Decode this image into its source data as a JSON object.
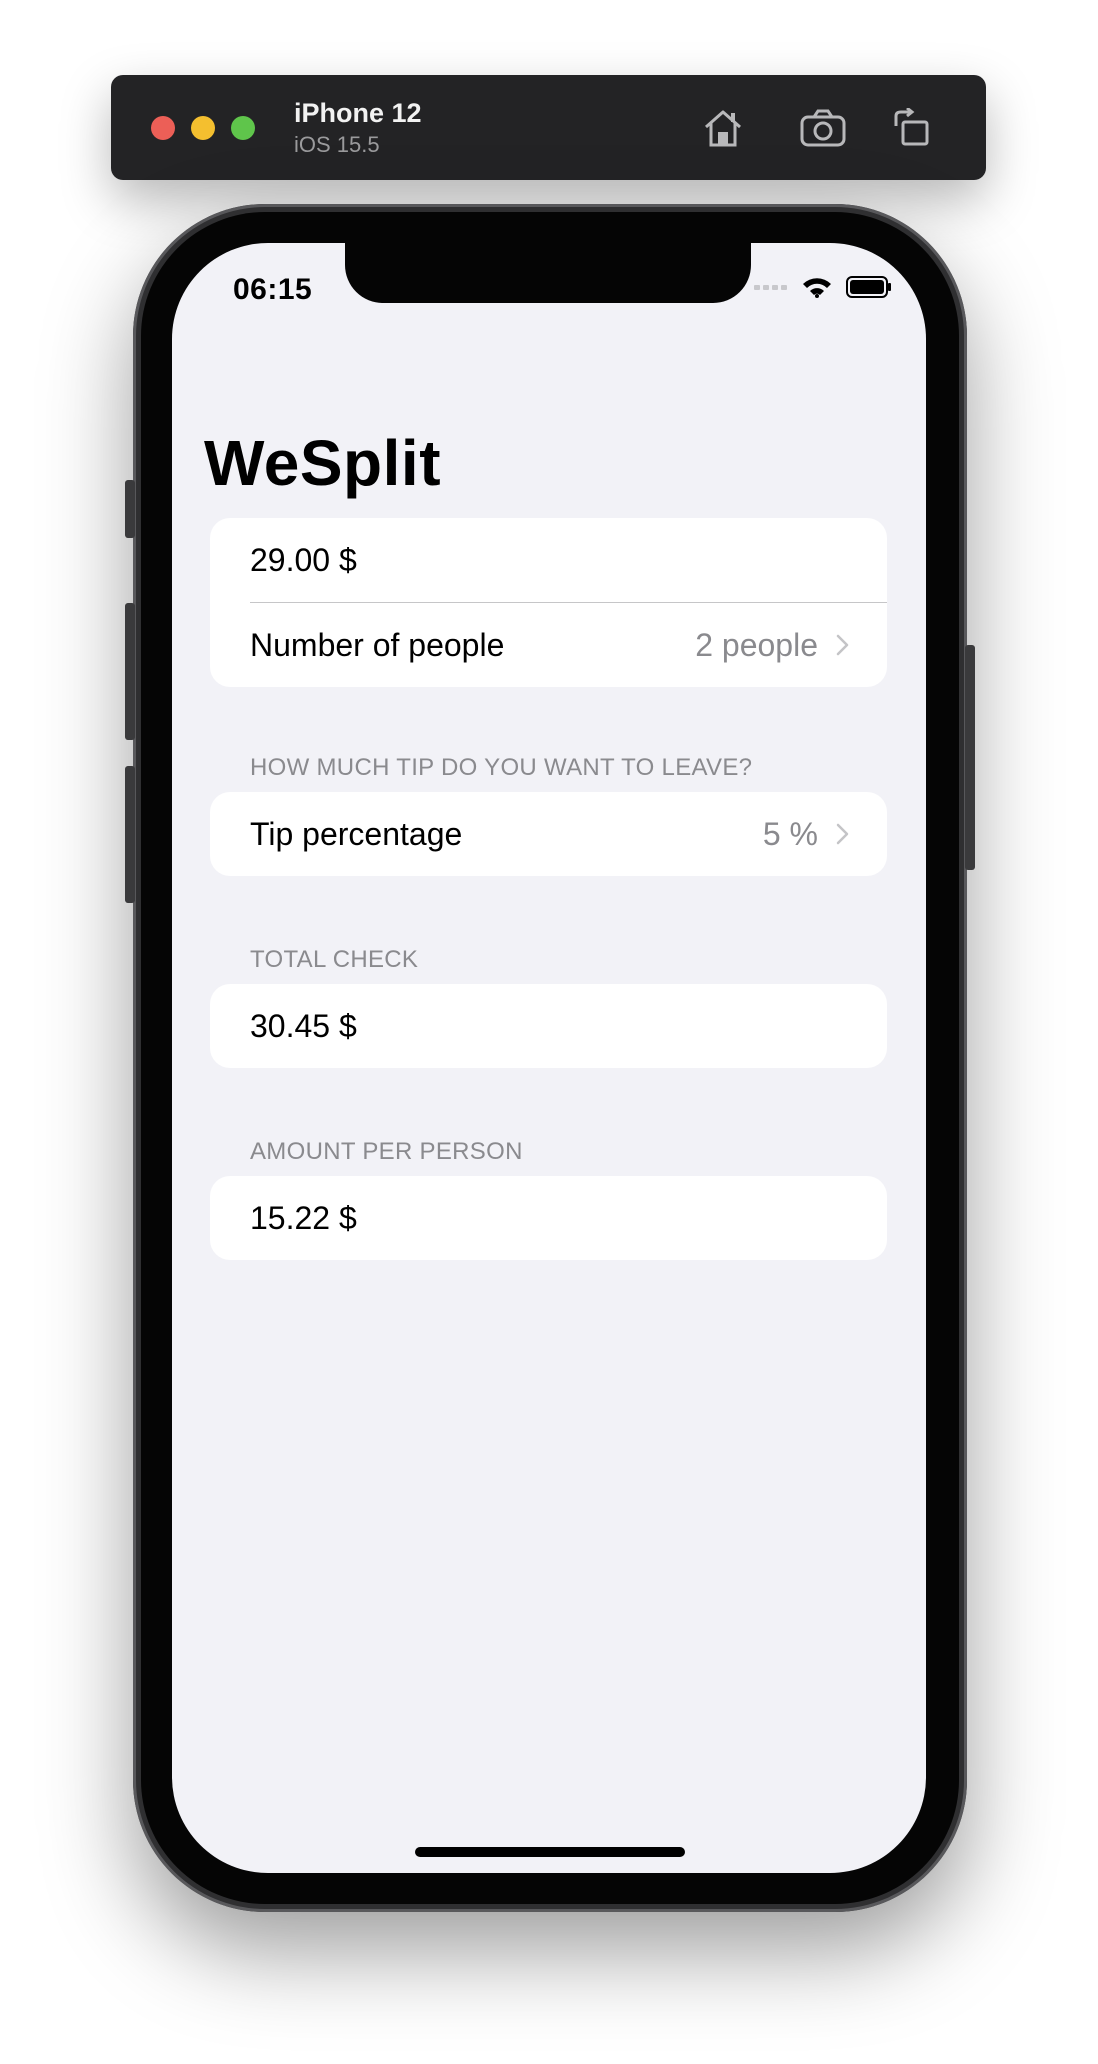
{
  "simulator": {
    "device_name": "iPhone 12",
    "os_version": "iOS 15.5",
    "icons": [
      "home-icon",
      "screenshot-icon",
      "rotate-icon"
    ],
    "traffic_colors": [
      "#ec5f57",
      "#f4bf2f",
      "#5fc54b"
    ]
  },
  "status_bar": {
    "time": "06:15",
    "icons": [
      "signal-icon",
      "wifi-icon",
      "battery-icon"
    ]
  },
  "app": {
    "title": "WeSplit",
    "check_amount": "29.00 $",
    "people_label": "Number of people",
    "people_value": "2 people",
    "tip_header": "HOW MUCH TIP DO YOU WANT TO LEAVE?",
    "tip_label": "Tip percentage",
    "tip_value": "5 %",
    "total_header": "TOTAL CHECK",
    "total_value": "30.45 $",
    "per_person_header": "AMOUNT PER PERSON",
    "per_person_value": "15.22 $"
  },
  "colors": {
    "background": "#f2f2f7",
    "card": "#ffffff",
    "secondary_text": "#8a8a8e"
  }
}
